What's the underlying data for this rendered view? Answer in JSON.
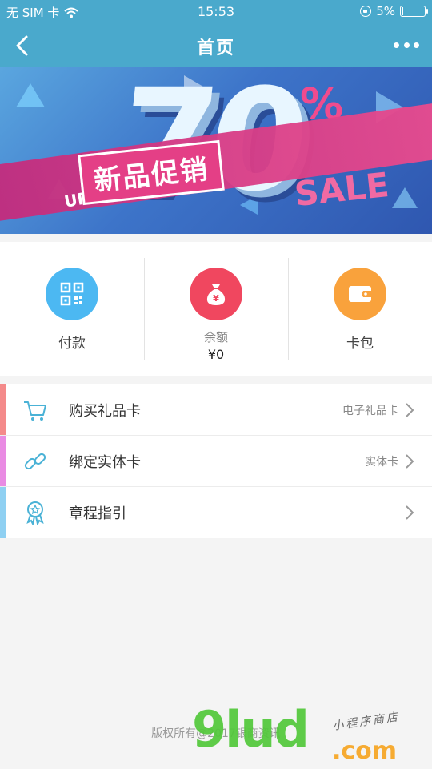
{
  "status_bar": {
    "carrier": "无 SIM 卡",
    "time": "15:53",
    "battery": "5%",
    "battery_level": 0.05,
    "icons": [
      "wifi-icon",
      "orientation-lock-icon",
      "battery-icon"
    ]
  },
  "nav": {
    "title": "首页",
    "icons": [
      "back-arrow-icon",
      "more-dots-icon"
    ]
  },
  "banner": {
    "up_to": "UP TO",
    "number": "70",
    "percent": "%",
    "headline": "新品促销",
    "sale": "SALE"
  },
  "actions": [
    {
      "label": "付款",
      "icon": "qr-code-icon",
      "color": "#4cb8f2"
    },
    {
      "label": "余额",
      "amount": "¥0",
      "icon": "money-bag-icon",
      "color": "#f0475f"
    },
    {
      "label": "卡包",
      "icon": "wallet-icon",
      "color": "#f9a23c"
    }
  ],
  "list": [
    {
      "label": "购买礼品卡",
      "sub": "电子礼品卡",
      "icon": "shopping-cart-icon",
      "accent": "#f48a8a"
    },
    {
      "label": "绑定实体卡",
      "sub": "实体卡",
      "icon": "link-icon",
      "accent": "#e98be3"
    },
    {
      "label": "章程指引",
      "sub": "",
      "icon": "award-badge-icon",
      "accent": "#8fd0f2"
    }
  ],
  "footer": {
    "copyright": "版权所有@2017银商资讯"
  },
  "watermark": {
    "main": "9lud",
    "com": ".com",
    "cn": "小程序商店"
  }
}
